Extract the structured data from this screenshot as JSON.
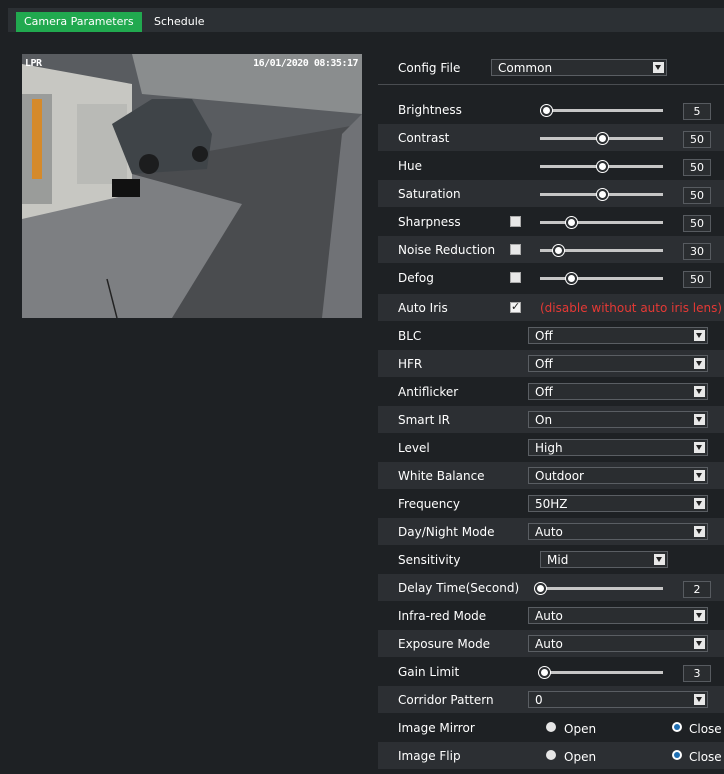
{
  "tabs": [
    {
      "label": "Camera Parameters",
      "active": true
    },
    {
      "label": "Schedule",
      "active": false
    }
  ],
  "preview": {
    "osd_left": "LPR",
    "osd_right": "16/01/2020 08:35:17"
  },
  "config_file": {
    "label": "Config File",
    "value": "Common"
  },
  "sliders": [
    {
      "label": "Brightness",
      "value": "5",
      "level": 0.05
    },
    {
      "label": "Contrast",
      "value": "50",
      "level": 0.5
    },
    {
      "label": "Hue",
      "value": "50",
      "level": 0.5
    },
    {
      "label": "Saturation",
      "value": "50",
      "level": 0.5
    },
    {
      "label": "Sharpness",
      "value": "50",
      "level": 0.25,
      "checkbox": false
    },
    {
      "label": "Noise Reduction",
      "value": "30",
      "level": 0.15,
      "checkbox": false
    },
    {
      "label": "Defog",
      "value": "50",
      "level": 0.25,
      "checkbox": false
    }
  ],
  "auto_iris": {
    "label": "Auto Iris",
    "checked": true,
    "note": "(disable without auto iris lens)"
  },
  "selects_a": [
    {
      "label": "BLC",
      "value": "Off"
    },
    {
      "label": "HFR",
      "value": "Off"
    },
    {
      "label": "Antiflicker",
      "value": "Off"
    },
    {
      "label": "Smart IR",
      "value": "On"
    },
    {
      "label": "Level",
      "value": "High"
    },
    {
      "label": "White Balance",
      "value": "Outdoor"
    },
    {
      "label": "Frequency",
      "value": "50HZ"
    },
    {
      "label": "Day/Night Mode",
      "value": "Auto"
    }
  ],
  "sensitivity": {
    "label": "Sensitivity",
    "value": "Mid"
  },
  "delay_time": {
    "label": "Delay Time(Second)",
    "value": "2",
    "level": 0.0
  },
  "infra_red": {
    "label": "Infra-red Mode",
    "value": "Auto"
  },
  "exposure": {
    "label": "Exposure Mode",
    "value": "Auto"
  },
  "gain_limit": {
    "label": "Gain Limit",
    "value": "3",
    "level": 0.03
  },
  "corridor": {
    "label": "Corridor Pattern",
    "value": "0"
  },
  "image_mirror": {
    "label": "Image Mirror",
    "open": "Open",
    "close": "Close",
    "selected": "Close"
  },
  "image_flip": {
    "label": "Image Flip",
    "open": "Open",
    "close": "Close",
    "selected": "Close"
  },
  "colors": {
    "accent": "#21a94f",
    "warning": "#e53935",
    "radio_dot": "#1f6fb3"
  }
}
